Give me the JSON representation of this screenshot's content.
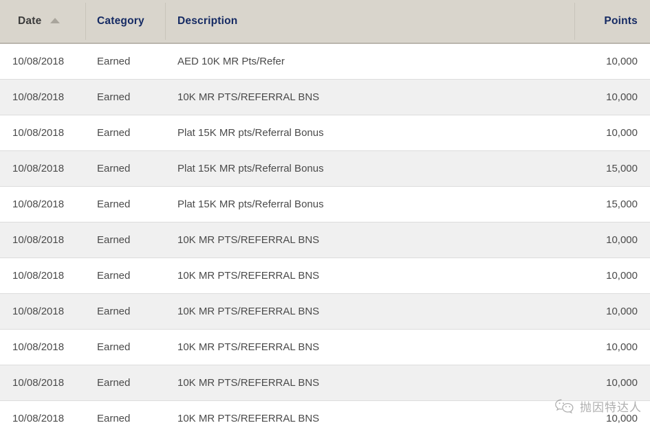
{
  "table": {
    "columns": [
      {
        "key": "date",
        "label": "Date",
        "sorted": true,
        "sort_direction": "asc",
        "align": "left",
        "color": "#3b3b3b"
      },
      {
        "key": "category",
        "label": "Category",
        "sorted": false,
        "align": "left",
        "color": "#152a63"
      },
      {
        "key": "description",
        "label": "Description",
        "sorted": false,
        "align": "left",
        "color": "#152a63"
      },
      {
        "key": "points",
        "label": "Points",
        "sorted": false,
        "align": "right",
        "color": "#152a63"
      }
    ],
    "rows": [
      {
        "date": "10/08/2018",
        "category": "Earned",
        "description": "AED 10K MR Pts/Refer",
        "points": "10,000"
      },
      {
        "date": "10/08/2018",
        "category": "Earned",
        "description": "10K MR PTS/REFERRAL BNS",
        "points": "10,000"
      },
      {
        "date": "10/08/2018",
        "category": "Earned",
        "description": "Plat 15K MR pts/Referral Bonus",
        "points": "10,000"
      },
      {
        "date": "10/08/2018",
        "category": "Earned",
        "description": "Plat 15K MR pts/Referral Bonus",
        "points": "15,000"
      },
      {
        "date": "10/08/2018",
        "category": "Earned",
        "description": "Plat 15K MR pts/Referral Bonus",
        "points": "15,000"
      },
      {
        "date": "10/08/2018",
        "category": "Earned",
        "description": "10K MR PTS/REFERRAL BNS",
        "points": "10,000"
      },
      {
        "date": "10/08/2018",
        "category": "Earned",
        "description": "10K MR PTS/REFERRAL BNS",
        "points": "10,000"
      },
      {
        "date": "10/08/2018",
        "category": "Earned",
        "description": "10K MR PTS/REFERRAL BNS",
        "points": "10,000"
      },
      {
        "date": "10/08/2018",
        "category": "Earned",
        "description": "10K MR PTS/REFERRAL BNS",
        "points": "10,000"
      },
      {
        "date": "10/08/2018",
        "category": "Earned",
        "description": "10K MR PTS/REFERRAL BNS",
        "points": "10,000"
      },
      {
        "date": "10/08/2018",
        "category": "Earned",
        "description": "10K MR PTS/REFERRAL BNS",
        "points": "10,000"
      }
    ]
  },
  "watermark": {
    "icon": "wechat-icon",
    "text": "抛因特达人"
  },
  "colors": {
    "header_background": "#d9d5cc",
    "header_link": "#152a63",
    "header_sorted": "#3b3b3b",
    "row_odd": "#ffffff",
    "row_even": "#f0f0f0",
    "row_border": "#dcdcdc",
    "body_text": "#4a4a4a"
  }
}
